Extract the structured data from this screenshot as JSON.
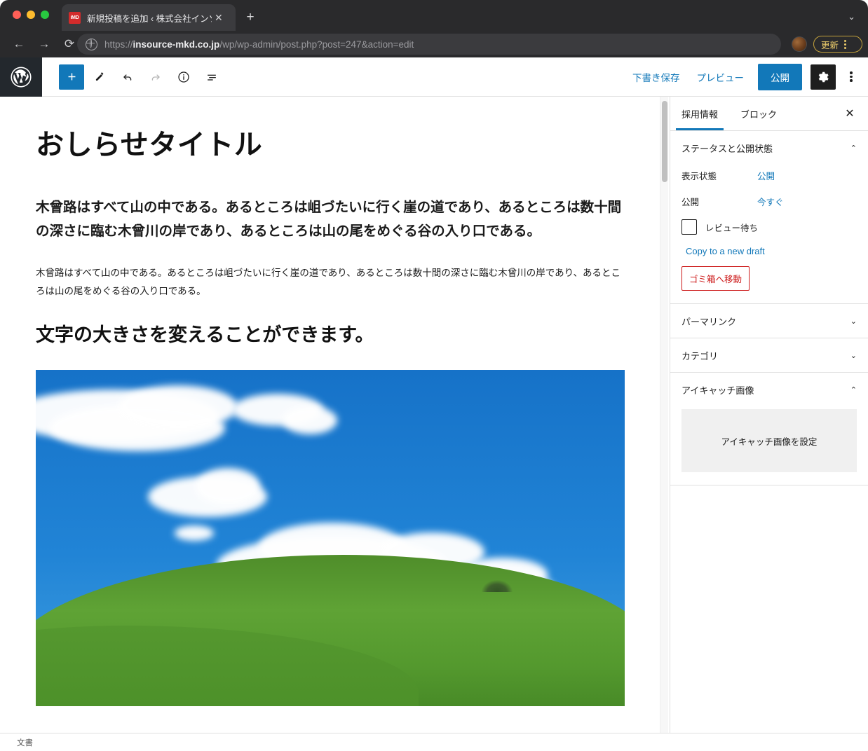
{
  "browser": {
    "tab": {
      "favicon_text": "iMD",
      "title": "新規投稿を追加 ‹ 株式会社インソー…",
      "close_label": "✕"
    },
    "new_tab_label": "+",
    "tab_list_caret": "⌄",
    "nav": {
      "back": "←",
      "forward": "→",
      "reload": "⟳"
    },
    "url_prefix": "https://",
    "url_domain": "insource-mkd.co.jp",
    "url_path": "/wp/wp-admin/post.php?post=247&action=edit",
    "update_button_label": "更新"
  },
  "editor_header": {
    "tools": {
      "add_block": "+",
      "tools_pencil": "✎",
      "undo": "↶",
      "redo": "↷",
      "details": "i",
      "list_view": "≡"
    },
    "save_draft_label": "下書き保存",
    "preview_label": "プレビュー",
    "publish_label": "公開",
    "settings_label": "⚙",
    "more_label": "⋮"
  },
  "post": {
    "title": "おしらせタイトル",
    "lead_paragraph": "木曾路はすべて山の中である。あるところは岨づたいに行く崖の道であり、あるところは数十間の深さに臨む木曾川の岸であり、あるところは山の尾をめぐる谷の入り口である。",
    "body_paragraph": "木曾路はすべて山の中である。あるところは岨づたいに行く崖の道であり、あるところは数十間の深さに臨む木曾川の岸であり、あるところは山の尾をめぐる谷の入り口である。",
    "sub_heading": "文字の大きさを変えることができます。",
    "image_alt": "青空と白い雲と緑の草原の丘"
  },
  "sidebar": {
    "tabs": [
      {
        "label": "採用情報",
        "active": true
      },
      {
        "label": "ブロック",
        "active": false
      }
    ],
    "close_label": "✕",
    "panels": [
      {
        "title": "ステータスと公開状態",
        "chevron": "⌃",
        "expanded": true,
        "rows": [
          {
            "label": "表示状態",
            "value": "公開"
          },
          {
            "label": "公開",
            "value": "今すぐ"
          }
        ],
        "checkbox_label": "レビュー待ち",
        "copy_link_label": "Copy to a new draft",
        "trash_label": "ゴミ箱へ移動"
      },
      {
        "title": "パーマリンク",
        "chevron": "⌄",
        "expanded": false
      },
      {
        "title": "カテゴリ",
        "chevron": "⌄",
        "expanded": false
      },
      {
        "title": "アイキャッチ画像",
        "chevron": "⌃",
        "expanded": true,
        "featured_button_label": "アイキャッチ画像を設定"
      }
    ]
  },
  "statusbar": {
    "document_label": "文書"
  },
  "colors": {
    "accent_blue": "#1278b9",
    "chrome_dark": "#2a2a2c",
    "wp_logo_bg": "#23282d",
    "danger_red": "#cc1818",
    "update_yellow": "#e8c96a",
    "sky_blue": "#2184d6",
    "grass_green": "#5a9a32"
  }
}
